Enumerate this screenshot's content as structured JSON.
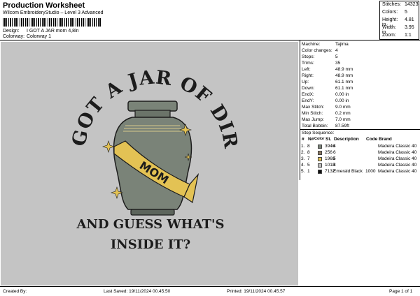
{
  "header": {
    "title": "Production Worksheet",
    "subtitle": "Wilcom EmbroideryStudio – Level 3 Advanced",
    "design_label": "Design:",
    "design_value": "I GOT A JAR mom 4,8in",
    "colorway_label": "Colorway:",
    "colorway_value": "Colorway 1"
  },
  "stats": [
    {
      "label": "Stitches:",
      "value": "14323"
    },
    {
      "label": "Colors:",
      "value": "5"
    },
    {
      "label": "Height:",
      "value": "4.81 in"
    },
    {
      "label": "Width:",
      "value": "3.95 in"
    },
    {
      "label": "Zoom:",
      "value": "1:1"
    }
  ],
  "artwork": {
    "top_text": "I GOT A JAR OF DIRT",
    "sash_text": "MOM",
    "bottom_line1": "AND GUESS WHAT'S",
    "bottom_line2": "INSIDE IT?",
    "colors": {
      "urn": "#7a8378",
      "urn_dark": "#5d655c",
      "sash": "#e3c254",
      "text": "#1c1c1c",
      "stripe": "#d6c98a"
    }
  },
  "machine": [
    {
      "label": "Machine:",
      "value": "Tajima"
    },
    {
      "label": "Color changes:",
      "value": "4"
    },
    {
      "label": "Stops:",
      "value": "5"
    },
    {
      "label": "Trims:",
      "value": "35"
    },
    {
      "label": "Left:",
      "value": "48.9 mm"
    },
    {
      "label": "Right:",
      "value": "48.9 mm"
    },
    {
      "label": "Up:",
      "value": "61.1 mm"
    },
    {
      "label": "Down:",
      "value": "61.1 mm"
    },
    {
      "label": "EndX:",
      "value": "0.00 in"
    },
    {
      "label": "EndY:",
      "value": "0.00 in"
    },
    {
      "label": "Max Stitch:",
      "value": "9.0 mm"
    },
    {
      "label": "Min Stitch:",
      "value": "0.2 mm"
    },
    {
      "label": "Max Jump:",
      "value": "7.0 mm"
    },
    {
      "label": "Total Bobbin:",
      "value": "87.59ft"
    }
  ],
  "sequence": {
    "title": "Stop Sequence:",
    "headers": {
      "num": "#",
      "n": "N#",
      "color": "Color",
      "st": "St.",
      "desc": "Description",
      "code": "Code",
      "brand": "Brand"
    },
    "rows": [
      {
        "num": "1.",
        "n": "8",
        "color": "#7a8378",
        "st": "3946",
        "desc": "4",
        "code": "",
        "brand": "Madeira Classic 40"
      },
      {
        "num": "2.",
        "n": "8",
        "color": "#8a7760",
        "st": "256",
        "desc": "6",
        "code": "",
        "brand": "Madeira Classic 40"
      },
      {
        "num": "3.",
        "n": "7",
        "color": "#e3c254",
        "st": "1969",
        "desc": "5",
        "code": "",
        "brand": "Madeira Classic 40"
      },
      {
        "num": "4.",
        "n": "5",
        "color": "#c0c0c0",
        "st": "1018",
        "desc": "3",
        "code": "",
        "brand": "Madeira Classic 40"
      },
      {
        "num": "5.",
        "n": "1",
        "color": "#111111",
        "st": "7132",
        "desc": "Emerald Black",
        "code": "1000",
        "brand": "Madeira Classic 40"
      }
    ]
  },
  "footer": {
    "created_by": "Created By:",
    "last_saved": "Last Saved: 19/11/2024 00.45.50",
    "printed": "Printed: 19/11/2024 00.45.57",
    "page": "Page 1 of 1"
  }
}
